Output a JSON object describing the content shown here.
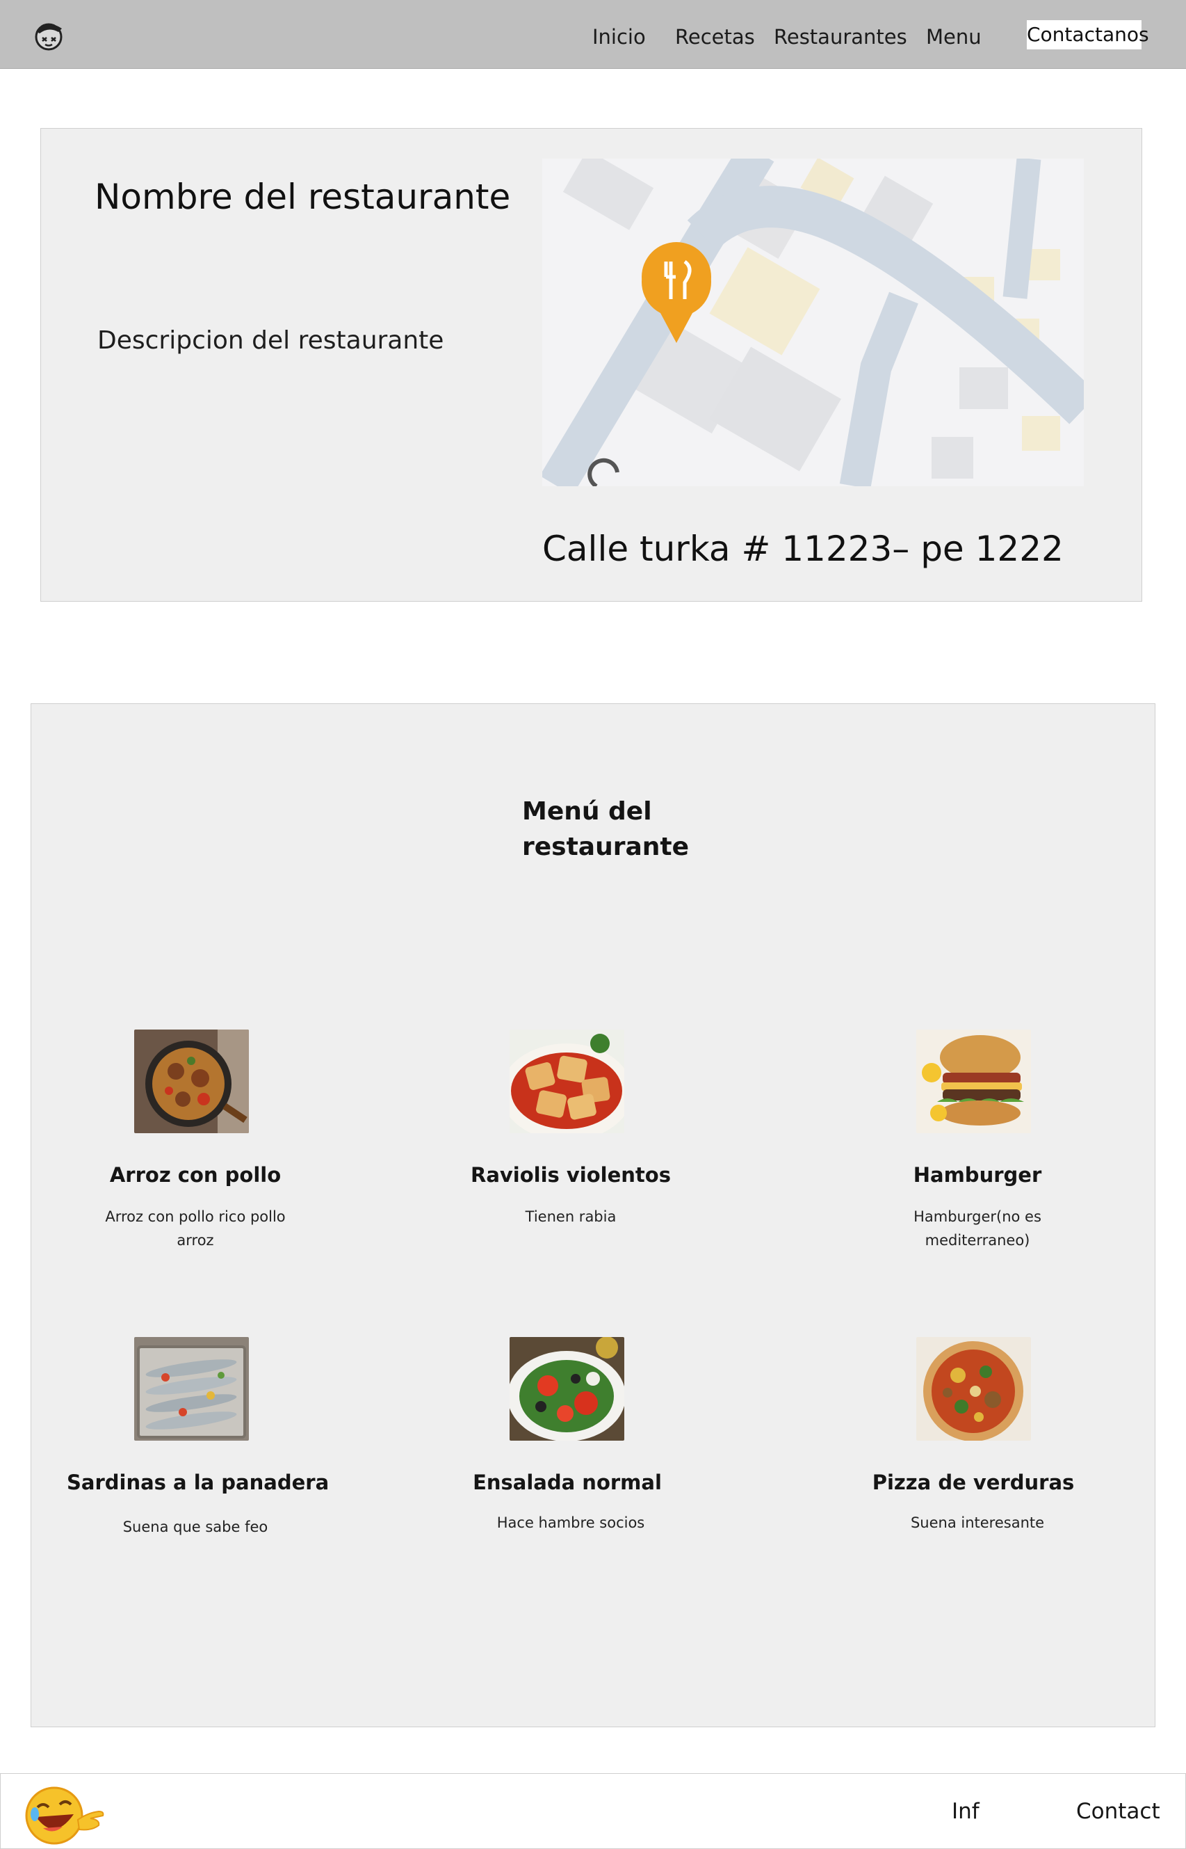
{
  "header": {
    "logo_icon": "cartoon-face-logo-icon",
    "nav": [
      {
        "label": "Inicio"
      },
      {
        "label": "Recetas"
      },
      {
        "label": "Restaurantes"
      },
      {
        "label": "Menu"
      }
    ],
    "contact_label": "Contactanos"
  },
  "restaurant": {
    "name": "Nombre del restaurante",
    "description": "Descripcion del restaurante",
    "address": "Calle turka # 11223– pe 1222",
    "map_pin_icon": "restaurant-pin-icon",
    "pin_color": "#F0A020"
  },
  "menu": {
    "title": "Menú del restaurante",
    "dishes": [
      {
        "name": "Arroz con pollo",
        "description": "Arroz con pollo rico pollo arroz",
        "image": "paella-pan-image"
      },
      {
        "name": "Raviolis violentos",
        "description": "Tienen rabia",
        "image": "ravioli-plate-image"
      },
      {
        "name": "Hamburger",
        "description": "Hamburger(no es mediterraneo)",
        "image": "hamburger-image"
      },
      {
        "name": "Sardinas a la panadera",
        "description": "Suena que sabe feo",
        "image": "sardines-tray-image"
      },
      {
        "name": "Ensalada normal",
        "description": "Hace hambre socios",
        "image": "salad-bowl-image"
      },
      {
        "name": "Pizza de verduras",
        "description": "Suena interesante",
        "image": "vegetable-pizza-image"
      }
    ]
  },
  "footer": {
    "emoji_icon": "laughing-pointing-emoji-icon",
    "links": [
      {
        "label": "Inf"
      },
      {
        "label": "Contact"
      }
    ]
  },
  "colors": {
    "header_bg": "#BFBFBF",
    "panel_bg": "#EFEFEF",
    "accent": "#F0A020"
  }
}
